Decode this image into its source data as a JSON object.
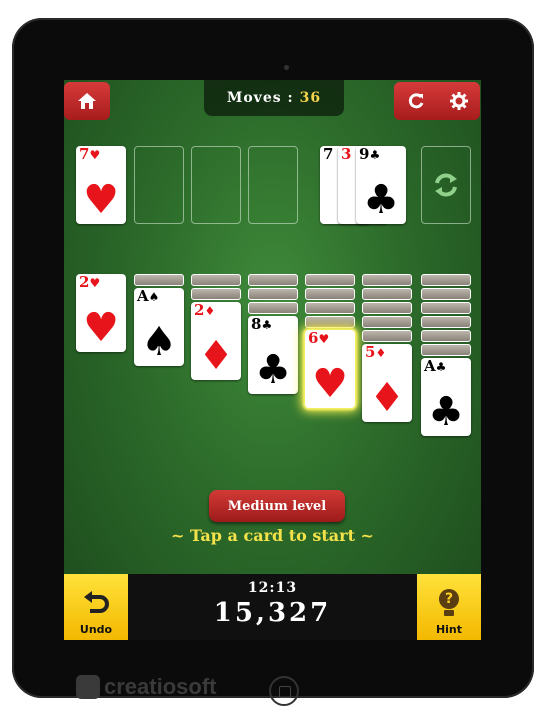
{
  "header": {
    "moves_label": "Moves :",
    "moves_value": "36",
    "home_icon": "home-icon",
    "restart_icon": "restart-icon",
    "settings_icon": "gear-icon"
  },
  "foundation": [
    {
      "rank": "7",
      "suit": "♥",
      "color": "red"
    }
  ],
  "waste": [
    {
      "rank": "7",
      "suit": "♠",
      "color": "black"
    },
    {
      "rank": "3",
      "suit": "♥",
      "color": "red"
    },
    {
      "rank": "9",
      "suit": "♣",
      "color": "black"
    }
  ],
  "stock_icon": "recycle-icon",
  "tableau": [
    {
      "hidden": 0,
      "rank": "2",
      "suit": "♥",
      "color": "red"
    },
    {
      "hidden": 1,
      "rank": "A",
      "suit": "♠",
      "color": "black"
    },
    {
      "hidden": 2,
      "rank": "2",
      "suit": "♦",
      "color": "red"
    },
    {
      "hidden": 3,
      "rank": "8",
      "suit": "♣",
      "color": "black"
    },
    {
      "hidden": 4,
      "rank": "6",
      "suit": "♥",
      "color": "red",
      "highlighted": true
    },
    {
      "hidden": 5,
      "rank": "5",
      "suit": "♦",
      "color": "red"
    },
    {
      "hidden": 6,
      "rank": "A",
      "suit": "♣",
      "color": "black"
    }
  ],
  "level_label": "Medium level",
  "prompt": "~ Tap a card to start ~",
  "footer": {
    "undo_label": "Undo",
    "hint_label": "Hint",
    "hint_symbol": "?",
    "time": "12:13",
    "score": "15,327"
  },
  "brand": "creatiosoft",
  "colors": {
    "red": "#e8141b",
    "felt": "#2c6a2a",
    "button_red": "#c02a2a",
    "button_yellow": "#ffd21f"
  }
}
